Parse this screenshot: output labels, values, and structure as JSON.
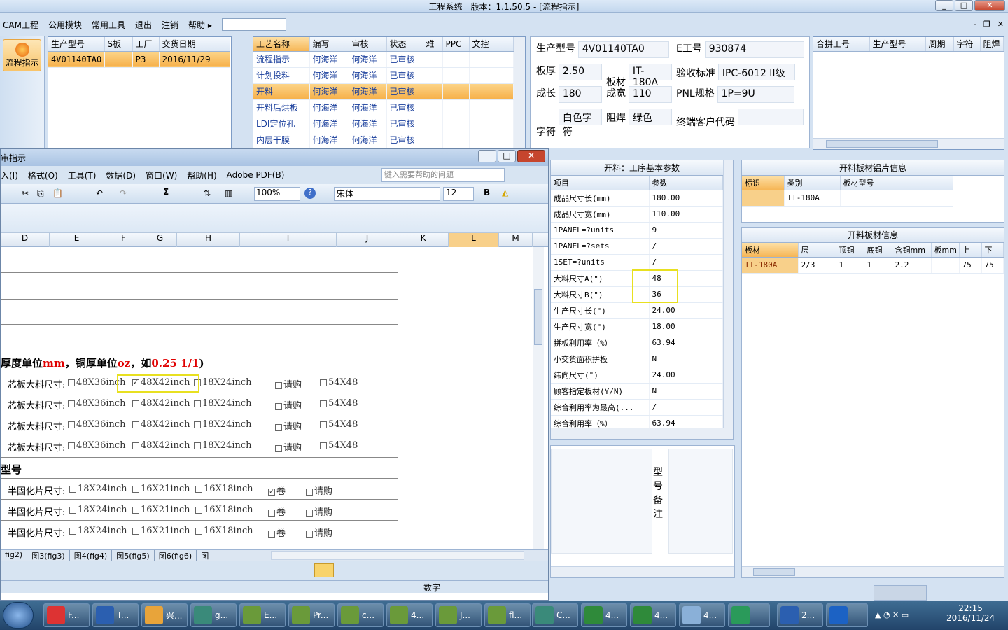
{
  "app": {
    "title": "工程系统　版本：1.1.50.5 - [流程指示]",
    "min": "_",
    "max": "□",
    "close": "✕"
  },
  "menu": [
    "CAM工程",
    "公用模块",
    "常用工具",
    "退出",
    "注销",
    "帮助"
  ],
  "mdi": {
    "min": "-",
    "restore": "❐",
    "close": "✕"
  },
  "left_button": {
    "label": "流程指示"
  },
  "orders": {
    "columns": [
      "生产型号",
      "S板",
      "工厂",
      "交货日期"
    ],
    "rows": [
      [
        "4V01140TA0",
        "",
        "P3",
        "2016/11/29"
      ]
    ]
  },
  "process": {
    "columns": [
      "工艺名称",
      "编写",
      "审核",
      "状态",
      "难",
      "PPC",
      "文控"
    ],
    "rows": [
      [
        "流程指示",
        "何海洋",
        "何海洋",
        "已审核"
      ],
      [
        "计划投料",
        "何海洋",
        "何海洋",
        "已审核"
      ],
      [
        "开料",
        "何海洋",
        "何海洋",
        "已审核"
      ],
      [
        "开料后烘板",
        "何海洋",
        "何海洋",
        "已审核"
      ],
      [
        "LDI定位孔",
        "何海洋",
        "何海洋",
        "已审核"
      ],
      [
        "内层干膜",
        "何海洋",
        "何海洋",
        "已审核"
      ]
    ],
    "selected": 2
  },
  "info": {
    "rows": [
      [
        {
          "l": "生产型号",
          "v": "4V01140TA0"
        },
        {
          "l": "E工号",
          "v": "930874"
        }
      ],
      [
        {
          "l": "板厚",
          "v": "2.50"
        },
        {
          "l": "板材",
          "v": "IT-180A"
        },
        {
          "l": "验收标准",
          "v": "IPC-6012 II级"
        }
      ],
      [
        {
          "l": "成长",
          "v": "180"
        },
        {
          "l": "成宽",
          "v": "110"
        },
        {
          "l": "PNL规格",
          "v": "1P=9U"
        }
      ],
      [
        {
          "l": "字符",
          "v": "白色字符"
        },
        {
          "l": "阻焊",
          "v": "绿色"
        },
        {
          "l": "终端客户代码",
          "v": ""
        }
      ]
    ]
  },
  "merge": {
    "columns": [
      "合拼工号",
      "生产型号",
      "周期",
      "字符",
      "阻焊"
    ]
  },
  "params": {
    "title": "开料：工序基本参数",
    "columns": [
      "项目",
      "参数"
    ],
    "rows": [
      [
        "成品尺寸长(mm)",
        "180.00"
      ],
      [
        "成品尺寸宽(mm)",
        "110.00"
      ],
      [
        "1PANEL=?units",
        "9"
      ],
      [
        "1PANEL=?sets",
        "/"
      ],
      [
        "1SET=?units",
        "/"
      ],
      [
        "大料尺寸A(\")",
        "48"
      ],
      [
        "大料尺寸B(\")",
        "36"
      ],
      [
        "生产尺寸长(\")",
        "24.00"
      ],
      [
        "生产尺寸宽(\")",
        "18.00"
      ],
      [
        "拼板利用率（%）",
        "63.94"
      ],
      [
        "小交货面积拼板",
        "N"
      ],
      [
        "纬向尺寸(\")",
        "24.00"
      ],
      [
        "顾客指定板材(Y/N)",
        "N"
      ],
      [
        "综合利用率为最高(...",
        "/"
      ],
      [
        "综合利用率（%）",
        "63.94"
      ]
    ]
  },
  "remarks": {
    "label": "型号备注"
  },
  "alu": {
    "title": "开料板材铝片信息",
    "columns": [
      "标识",
      "类别",
      "板材型号"
    ],
    "rows": [
      [
        "",
        "IT-180A",
        ""
      ]
    ]
  },
  "board": {
    "title": "开料板材信息",
    "columns": [
      "板材",
      "层",
      "顶铜",
      "底铜",
      "含铜mm",
      "板mm",
      "上",
      "下"
    ],
    "rows": [
      [
        "IT-180A",
        "2/3",
        "1",
        "1",
        "2.2",
        "",
        "75",
        "75"
      ]
    ]
  },
  "excel": {
    "title": "审指示",
    "menu": [
      "入(I)",
      "格式(O)",
      "工具(T)",
      "数据(D)",
      "窗口(W)",
      "帮助(H)",
      "Adobe PDF(B)"
    ],
    "help_placeholder": "键入需要帮助的问题",
    "zoom": "100%",
    "font": "宋体",
    "size": "12",
    "cols": [
      "D",
      "E",
      "F",
      "G",
      "H",
      "I",
      "J",
      "K",
      "L",
      "M"
    ],
    "note_black": "厚度单位",
    "note_red1": "mm",
    "note_black2": "，铜厚单位",
    "note_red2": "oz",
    "note_black3": "，如",
    "note_red3": "0.25 1/1",
    "note_end": ")",
    "core_label": "芯板大料尺寸:",
    "core_opts": [
      "48X36inch",
      "48X42inch",
      "18X24inch",
      "请购",
      "54X48"
    ],
    "section2": "型号",
    "pp_label": "半固化片尺寸:",
    "pp_opts": [
      "18X24inch",
      "16X21inch",
      "16X18inch",
      "卷",
      "请购"
    ],
    "tabs": [
      "fig2)",
      "图3(fig3)",
      "图4(fig4)",
      "图5(fig5)",
      "图6(fig6)",
      "图"
    ],
    "status": "数字"
  },
  "taskbar": {
    "items": [
      "F...",
      "T...",
      "兴...",
      "g...",
      "E...",
      "Pr...",
      "c...",
      "4...",
      "J...",
      "fl...",
      "C...",
      "4...",
      "4...",
      "4...",
      "",
      "2..."
    ],
    "time": "22:15",
    "date": "2016/11/24"
  }
}
